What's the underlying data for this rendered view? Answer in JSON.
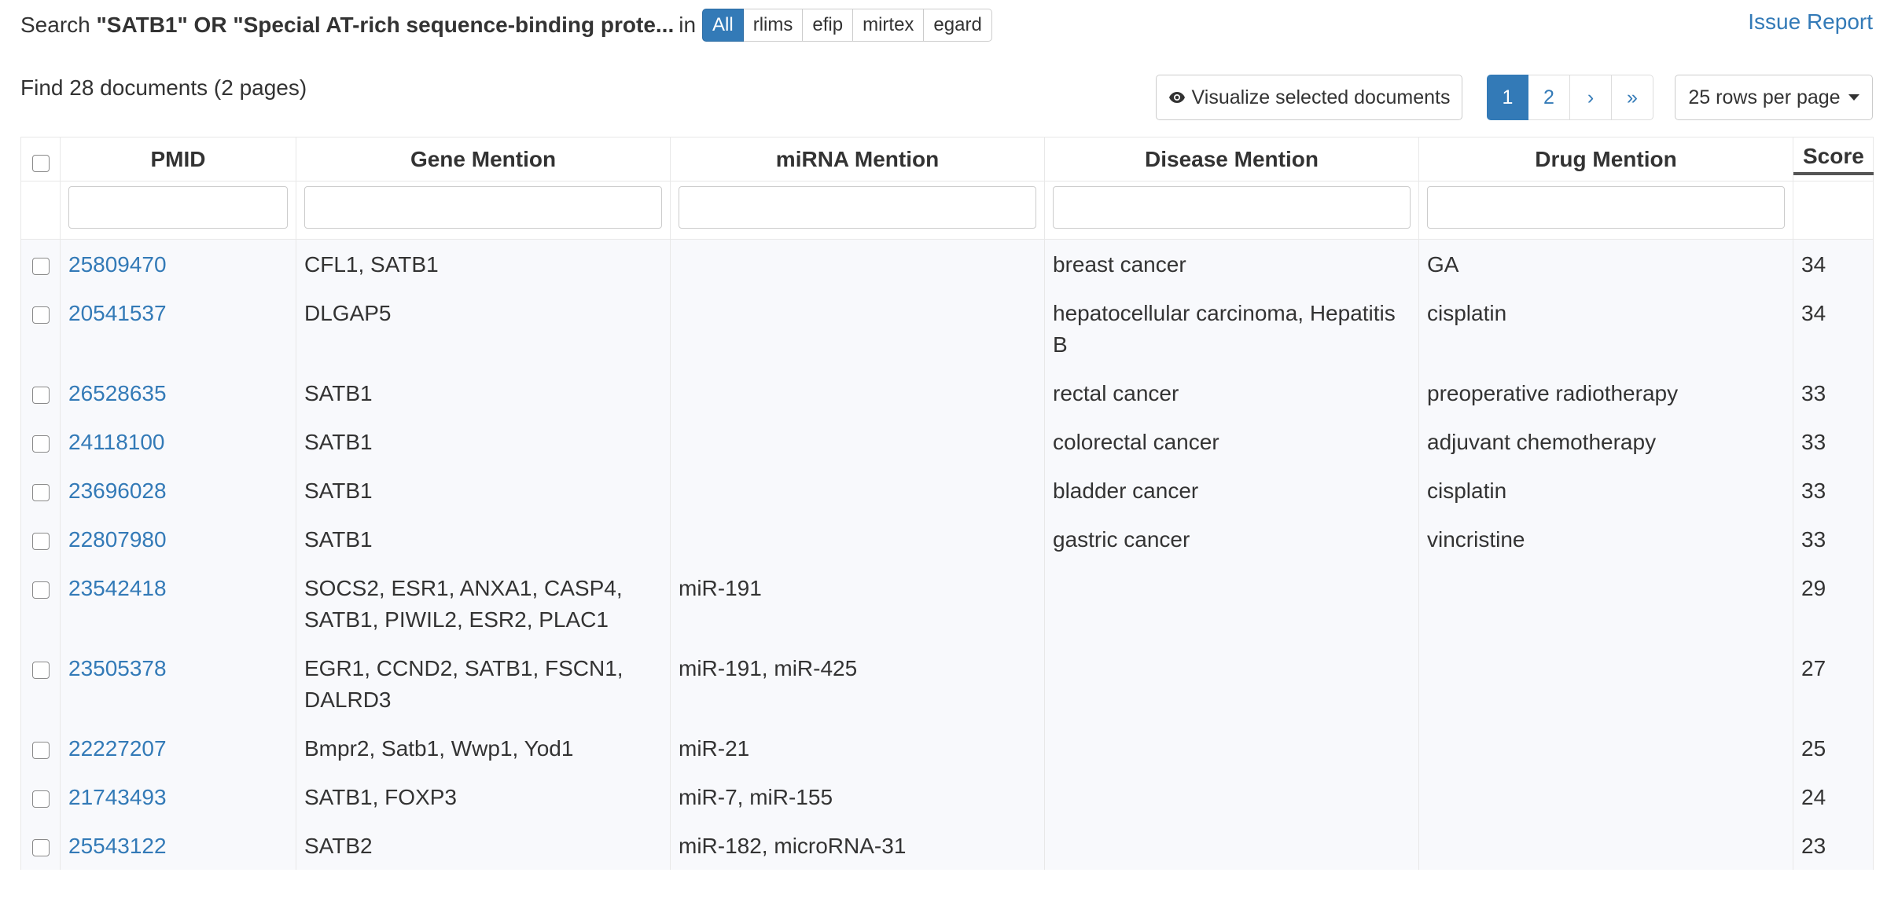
{
  "search": {
    "prefix": "Search",
    "query": "\"SATB1\" OR \"Special AT-rich sequence-binding prote...",
    "in_label": "in",
    "sources": [
      "All",
      "rlims",
      "efip",
      "mirtex",
      "egard"
    ],
    "active_source": "All"
  },
  "issue_report": "Issue Report",
  "find_info": "Find 28 documents (2 pages)",
  "visualize_label": "Visualize selected documents",
  "pagination": [
    "1",
    "2",
    "›",
    "»"
  ],
  "active_page": "1",
  "rows_per_page_label": "25 rows per page",
  "table": {
    "columns": [
      "PMID",
      "Gene Mention",
      "miRNA Mention",
      "Disease Mention",
      "Drug Mention",
      "Score"
    ],
    "rows": [
      {
        "pmid": "25809470",
        "gene": "CFL1, SATB1",
        "mirna": "",
        "disease": "breast cancer",
        "drug": "GA",
        "score": "34"
      },
      {
        "pmid": "20541537",
        "gene": "DLGAP5",
        "mirna": "",
        "disease": "hepatocellular carcinoma, Hepatitis B",
        "drug": "cisplatin",
        "score": "34"
      },
      {
        "pmid": "26528635",
        "gene": "SATB1",
        "mirna": "",
        "disease": "rectal cancer",
        "drug": "preoperative radiotherapy",
        "score": "33"
      },
      {
        "pmid": "24118100",
        "gene": "SATB1",
        "mirna": "",
        "disease": "colorectal cancer",
        "drug": "adjuvant chemotherapy",
        "score": "33"
      },
      {
        "pmid": "23696028",
        "gene": "SATB1",
        "mirna": "",
        "disease": "bladder cancer",
        "drug": "cisplatin",
        "score": "33"
      },
      {
        "pmid": "22807980",
        "gene": "SATB1",
        "mirna": "",
        "disease": "gastric cancer",
        "drug": "vincristine",
        "score": "33"
      },
      {
        "pmid": "23542418",
        "gene": "SOCS2, ESR1, ANXA1, CASP4, SATB1, PIWIL2, ESR2, PLAC1",
        "mirna": "miR-191",
        "disease": "",
        "drug": "",
        "score": "29"
      },
      {
        "pmid": "23505378",
        "gene": "EGR1, CCND2, SATB1, FSCN1, DALRD3",
        "mirna": "miR-191, miR-425",
        "disease": "",
        "drug": "",
        "score": "27"
      },
      {
        "pmid": "22227207",
        "gene": "Bmpr2, Satb1, Wwp1, Yod1",
        "mirna": "miR-21",
        "disease": "",
        "drug": "",
        "score": "25"
      },
      {
        "pmid": "21743493",
        "gene": "SATB1, FOXP3",
        "mirna": "miR-7, miR-155",
        "disease": "",
        "drug": "",
        "score": "24"
      },
      {
        "pmid": "25543122",
        "gene": "SATB2",
        "mirna": "miR-182, microRNA-31",
        "disease": "",
        "drug": "",
        "score": "23"
      }
    ]
  },
  "icons": {
    "visualize": "eye-icon",
    "rows_dropdown": "caret-down-icon"
  }
}
